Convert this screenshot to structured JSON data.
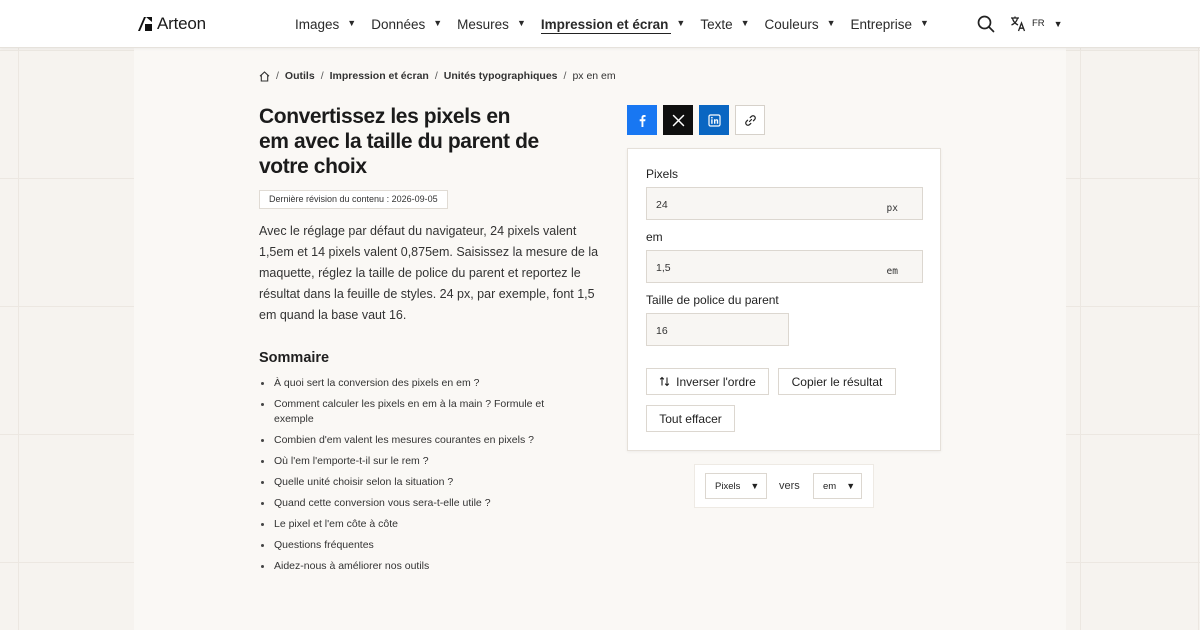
{
  "brand": {
    "name": "Arteon"
  },
  "nav": {
    "items": [
      {
        "label": "Images",
        "active": false
      },
      {
        "label": "Données",
        "active": false
      },
      {
        "label": "Mesures",
        "active": false
      },
      {
        "label": "Impression et écran",
        "active": true
      },
      {
        "label": "Texte",
        "active": false
      },
      {
        "label": "Couleurs",
        "active": false
      },
      {
        "label": "Entreprise",
        "active": false
      }
    ],
    "caret": "▼",
    "language": "FR"
  },
  "breadcrumb": {
    "items": [
      "Outils",
      "Impression et écran",
      "Unités typographiques"
    ],
    "current": "px en em",
    "separator": "/"
  },
  "article": {
    "title": "Convertissez les pixels en em avec la taille du parent de votre choix",
    "revision": "Dernière révision du contenu : 2026-09-05",
    "intro": "Avec le réglage par défaut du navigateur, 24 pixels valent 1,5em et 14 pixels valent 0,875em. Saisissez la mesure de la maquette, réglez la taille de police du parent et reportez le résultat dans la feuille de styles. 24 px, par exemple, font 1,5 em quand la base vaut 16.",
    "toc_title": "Sommaire",
    "toc": [
      "À quoi sert la conversion des pixels en em ?",
      "Comment calculer les pixels en em à la main ? Formule et exemple",
      "Combien d'em valent les mesures courantes en pixels ?",
      "Où l'em l'emporte-t-il sur le rem ?",
      "Quelle unité choisir selon la situation ?",
      "Quand cette conversion vous sera-t-elle utile ?",
      "Le pixel et l'em côte à côte",
      "Questions fréquentes",
      "Aidez-nous à améliorer nos outils"
    ]
  },
  "converter": {
    "pixels": {
      "label": "Pixels",
      "value": "24",
      "unit": "px"
    },
    "em": {
      "label": "em",
      "value": "1,5",
      "unit": "em"
    },
    "parent": {
      "label": "Taille de police du parent",
      "value": "16"
    },
    "buttons": {
      "swap": "Inverser l'ordre",
      "copy": "Copier le résultat",
      "clear": "Tout effacer"
    }
  },
  "unit_selector": {
    "from": "Pixels",
    "connector": "vers",
    "to": "em"
  },
  "colors": {
    "facebook": "#1877f2",
    "x": "#0f0f0f",
    "linkedin": "#0a66c2"
  },
  "icons": {
    "search": "search-icon",
    "language": "translate-icon",
    "home": "home-icon",
    "facebook": "facebook-icon",
    "x": "x-icon",
    "linkedin": "linkedin-icon",
    "link": "link-icon",
    "swap": "swap-icon"
  }
}
